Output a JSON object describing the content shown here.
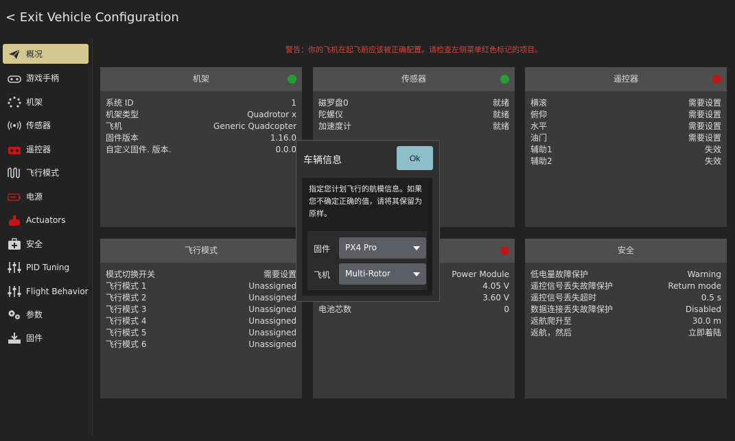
{
  "header": {
    "back_label": "< Exit Vehicle Configuration"
  },
  "warning": "警告：你的飞机在起飞前应该被正确配置。请检查左侧菜单红色标记的项目。",
  "sidebar": {
    "items": [
      {
        "label": "概况",
        "icon": "paper-plane-icon",
        "active": true
      },
      {
        "label": "游戏手柄",
        "icon": "gamepad-icon"
      },
      {
        "label": "机架",
        "icon": "airframe-dots-icon"
      },
      {
        "label": "传感器",
        "icon": "sensor-waves-icon"
      },
      {
        "label": "遥控器",
        "icon": "radio-controller-icon"
      },
      {
        "label": "飞行模式",
        "icon": "flight-mode-wave-icon"
      },
      {
        "label": "电源",
        "icon": "battery-icon"
      },
      {
        "label": "Actuators",
        "icon": "actuator-motor-icon"
      },
      {
        "label": "安全",
        "icon": "safety-kit-icon"
      },
      {
        "label": "PID Tuning",
        "icon": "sliders-icon"
      },
      {
        "label": "Flight Behavior",
        "icon": "sliders-icon"
      },
      {
        "label": "参数",
        "icon": "gears-icon"
      },
      {
        "label": "固件",
        "icon": "firmware-download-icon"
      }
    ]
  },
  "colors": {
    "status_green": "#1fa030",
    "status_red": "#c01818",
    "accent": "#d3c891",
    "warning": "#d4473d",
    "ok_button": "#8cbfc9"
  },
  "panels": {
    "airframe": {
      "title": "机架",
      "status": "green",
      "rows": [
        {
          "label": "系统 ID",
          "value": "1"
        },
        {
          "label": "机架类型",
          "value": "Quadrotor x"
        },
        {
          "label": "飞机",
          "value": "Generic Quadcopter"
        },
        {
          "label": "固件版本",
          "value": "1.16.0"
        },
        {
          "label": "自定义固件. 版本.",
          "value": "0.0.0"
        }
      ]
    },
    "sensors": {
      "title": "传感器",
      "status": "green",
      "rows": [
        {
          "label": "磁罗盘0",
          "value": "就绪"
        },
        {
          "label": "陀螺仪",
          "value": "就绪"
        },
        {
          "label": "加速度计",
          "value": "就绪"
        }
      ]
    },
    "radio": {
      "title": "遥控器",
      "status": "red",
      "rows": [
        {
          "label": "横滚",
          "value": "需要设置"
        },
        {
          "label": "俯仰",
          "value": "需要设置"
        },
        {
          "label": "水平",
          "value": "需要设置"
        },
        {
          "label": "油门",
          "value": "需要设置"
        },
        {
          "label": "辅助1",
          "value": "失效"
        },
        {
          "label": "辅助2",
          "value": "失效"
        }
      ]
    },
    "flight_modes": {
      "title": "飞行模式",
      "rows": [
        {
          "label": "模式切换开关",
          "value": "需要设置"
        },
        {
          "label": "飞行模式 1",
          "value": "Unassigned"
        },
        {
          "label": "飞行模式 2",
          "value": "Unassigned"
        },
        {
          "label": "飞行模式 3",
          "value": "Unassigned"
        },
        {
          "label": "飞行模式 4",
          "value": "Unassigned"
        },
        {
          "label": "飞行模式 5",
          "value": "Unassigned"
        },
        {
          "label": "飞行模式 6",
          "value": "Unassigned"
        }
      ]
    },
    "power": {
      "title": "",
      "status": "red",
      "rows": [
        {
          "label": "",
          "value": "Power Module"
        },
        {
          "label": "",
          "value": "4.05 V"
        },
        {
          "label": "",
          "value": "3.60 V"
        },
        {
          "label": "电池芯数",
          "value": "0"
        }
      ]
    },
    "safety": {
      "title": "安全",
      "rows": [
        {
          "label": "低电量故障保护",
          "value": "Warning"
        },
        {
          "label": "遥控信号丢失故障保护",
          "value": "Return mode"
        },
        {
          "label": "遥控信号丢失超时",
          "value": "0.5 s"
        },
        {
          "label": "数据连接丢失故障保护",
          "value": "Disabled"
        },
        {
          "label": "返航爬升至",
          "value": "30.0 m"
        },
        {
          "label": "返航，然后",
          "value": "立即着陆"
        }
      ]
    }
  },
  "dialog": {
    "title": "车辆信息",
    "ok_label": "Ok",
    "text": "指定您计划飞行的航模信息。如果您不确定正确的值，请将其保留为原样。",
    "firmware_label": "固件",
    "firmware_value": "PX4 Pro",
    "vehicle_label": "飞机",
    "vehicle_value": "Multi-Rotor"
  }
}
